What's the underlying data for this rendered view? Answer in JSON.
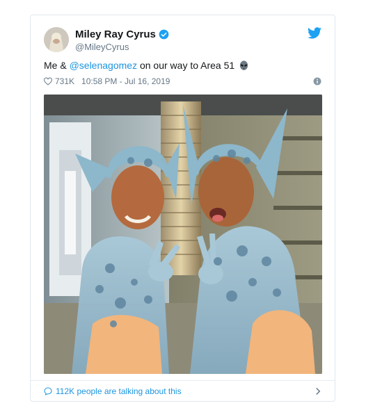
{
  "tweet": {
    "author_name": "Miley Ray Cyrus",
    "author_handle": "@MileyCyrus",
    "text_before": "Me & ",
    "mention": "@selenagomez",
    "text_after": " on our way to Area 51",
    "emoji_icon": "alien-emoji-icon",
    "likes": "731K",
    "timestamp": "10:58 PM - Jul 16, 2019",
    "talking": "112K people are talking about this"
  },
  "icons": {
    "verified": "verified-badge-icon",
    "twitter": "twitter-bird-icon",
    "like": "heart-icon",
    "info": "info-icon",
    "reply": "speech-bubble-icon",
    "chevron": "chevron-right-icon"
  },
  "colors": {
    "link": "#1b95e0",
    "text": "#14171a",
    "muted": "#657786",
    "border": "#e1e8ed"
  }
}
